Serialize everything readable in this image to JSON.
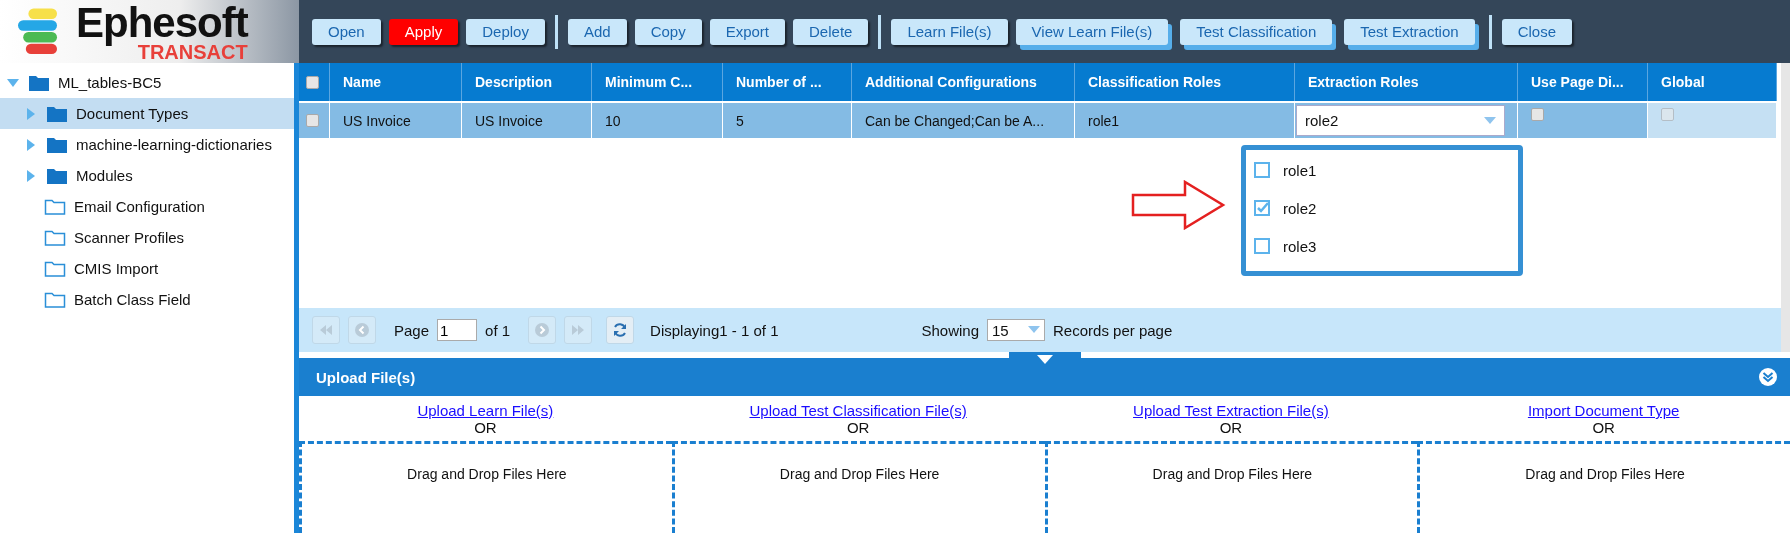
{
  "logo": {
    "name": "Ephesoft",
    "product": "TRANSACT"
  },
  "toolbar": {
    "groups": [
      [
        {
          "label": "Open",
          "kind": "plain"
        },
        {
          "label": "Apply",
          "kind": "alert"
        },
        {
          "label": "Deploy",
          "kind": "plain"
        }
      ],
      [
        {
          "label": "Add",
          "kind": "plain"
        },
        {
          "label": "Copy",
          "kind": "plain"
        },
        {
          "label": "Export",
          "kind": "plain"
        },
        {
          "label": "Delete",
          "kind": "plain"
        }
      ],
      [
        {
          "label": "Learn File(s)",
          "kind": "plain"
        },
        {
          "label": "View Learn File(s)",
          "kind": "stacked"
        },
        {
          "label": "Test Classification",
          "kind": "stacked"
        },
        {
          "label": "Test Extraction",
          "kind": "stacked"
        }
      ],
      [
        {
          "label": "Close",
          "kind": "plain"
        }
      ]
    ]
  },
  "tree": {
    "label": "ML_tables-BC5",
    "expanded": true,
    "children": [
      {
        "label": "Document Types",
        "kind": "branch",
        "expanded": false,
        "selected": true
      },
      {
        "label": "machine-learning-dictionaries",
        "kind": "branch",
        "expanded": false,
        "selected": false
      },
      {
        "label": "Modules",
        "kind": "branch",
        "expanded": false,
        "selected": false
      },
      {
        "label": "Email Configuration",
        "kind": "leaf",
        "selected": false
      },
      {
        "label": "Scanner Profiles",
        "kind": "leaf",
        "selected": false
      },
      {
        "label": "CMIS Import",
        "kind": "leaf",
        "selected": false
      },
      {
        "label": "Batch Class Field",
        "kind": "leaf",
        "selected": false
      }
    ]
  },
  "grid": {
    "header_checked": false,
    "columns": [
      "Name",
      "Description",
      "Minimum C...",
      "Number of ...",
      "Additional Configurations",
      "Classification Roles",
      "Extraction Roles",
      "Use Page Di...",
      "Global"
    ],
    "rows": [
      {
        "selected": true,
        "checked": false,
        "cells": [
          {
            "kind": "text",
            "value": "US Invoice"
          },
          {
            "kind": "text",
            "value": "US Invoice"
          },
          {
            "kind": "text",
            "value": "10"
          },
          {
            "kind": "text",
            "value": "5"
          },
          {
            "kind": "text",
            "value": "Can be Changed;Can be A..."
          },
          {
            "kind": "text",
            "value": "role1"
          },
          {
            "kind": "select",
            "value": "role2"
          },
          {
            "kind": "checkbox",
            "checked": false,
            "disabled": false
          },
          {
            "kind": "checkbox",
            "checked": false,
            "disabled": true
          }
        ]
      }
    ],
    "dropdown": [
      {
        "label": "role1",
        "checked": false
      },
      {
        "label": "role2",
        "checked": true
      },
      {
        "label": "role3",
        "checked": false
      }
    ]
  },
  "pager": {
    "page_label": "Page",
    "page": "1",
    "of": "of 1",
    "displaying": "Displaying1 - 1 of 1",
    "showing_label": "Showing",
    "per_page": "15",
    "per_page_label": "Records per page"
  },
  "upload": {
    "title": "Upload File(s)",
    "sections": [
      {
        "link": "Upload Learn File(s)",
        "or": "OR",
        "drop": "Drag and Drop Files Here"
      },
      {
        "link": "Upload Test Classification File(s)",
        "or": "OR",
        "drop": "Drag and Drop Files Here"
      },
      {
        "link": "Upload Test Extraction File(s)",
        "or": "OR",
        "drop": "Drag and Drop Files Here"
      },
      {
        "link": "Import Document Type",
        "or": "OR",
        "drop": "Drag and Drop Files Here"
      }
    ]
  }
}
